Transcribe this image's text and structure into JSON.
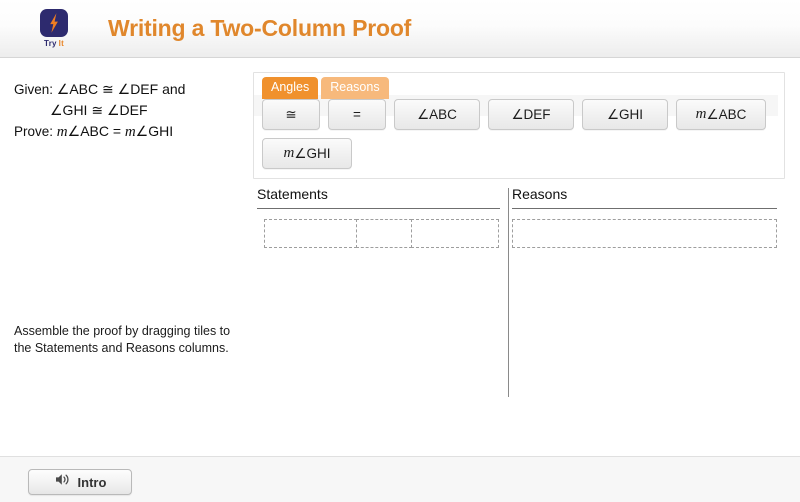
{
  "header": {
    "title": "Writing a Two-Column Proof",
    "logo": {
      "icon": "lightning-bolt-icon",
      "caption_primary": "Try",
      "caption_secondary": "It"
    },
    "accent_color": "#e0872c"
  },
  "problem": {
    "given_label": "Given:",
    "given_line1": "∠ABC ≅ ∠DEF and",
    "given_line2": "∠GHI ≅ ∠DEF",
    "prove_label": "Prove:",
    "prove_m1": "m",
    "prove_part1": "∠ABC =",
    "prove_m2": "m",
    "prove_part2": "∠GHI",
    "instruction": "Assemble the proof by dragging tiles to the Statements and Reasons columns."
  },
  "tray": {
    "tabs": [
      {
        "label": "Angles",
        "active": true,
        "color": "#f0912d"
      },
      {
        "label": "Reasons",
        "active": false,
        "color": "#f7b97c"
      }
    ],
    "tiles_row1": [
      {
        "text": "≅",
        "size": "sm"
      },
      {
        "text": "=",
        "size": "sm"
      },
      {
        "text": "∠ABC",
        "size": "md"
      },
      {
        "text": "∠DEF",
        "size": "md"
      },
      {
        "text": "∠GHI",
        "size": "md"
      },
      {
        "text_italic": "m",
        "text": "∠ABC",
        "size": "lg"
      }
    ],
    "tiles_row2": [
      {
        "text_italic": "m",
        "text": "∠GHI",
        "size": "lg"
      }
    ]
  },
  "proof": {
    "statements_header": "Statements",
    "reasons_header": "Reasons",
    "statement_slots": [
      {
        "value": "",
        "width": "a"
      },
      {
        "value": "",
        "width": "b"
      },
      {
        "value": "",
        "width": "c"
      }
    ],
    "reason_slots": [
      {
        "value": "",
        "width": "reason"
      }
    ]
  },
  "footer": {
    "intro_button_label": "Intro",
    "intro_button_icon": "speaker-icon"
  }
}
